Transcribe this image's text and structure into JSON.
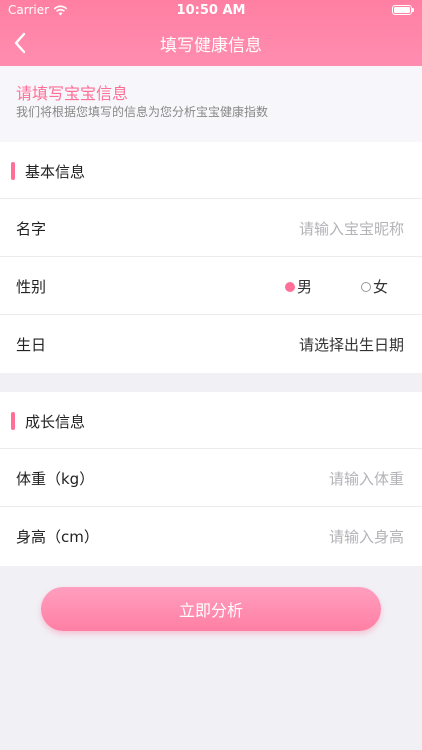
{
  "status_bar": {
    "carrier": "Carrier",
    "time": "10:50 AM"
  },
  "nav": {
    "title": "填写健康信息"
  },
  "intro": {
    "title": "请填写宝宝信息",
    "subtitle": "我们将根据您填写的信息为您分析宝宝健康指数"
  },
  "basic": {
    "section_title": "基本信息",
    "name_label": "名字",
    "name_placeholder": "请输入宝宝昵称",
    "gender_label": "性别",
    "gender_options": [
      "男",
      "女"
    ],
    "gender_selected": "男",
    "birthday_label": "生日",
    "birthday_placeholder": "请选择出生日期"
  },
  "growth": {
    "section_title": "成长信息",
    "weight_label": "体重（kg）",
    "weight_placeholder": "请输入体重",
    "height_label": "身高（cm）",
    "height_placeholder": "请输入身高"
  },
  "submit_label": "立即分析",
  "colors": {
    "accent": "#ff6f98",
    "header": "#ff85a8",
    "background": "#f1f0f5"
  }
}
